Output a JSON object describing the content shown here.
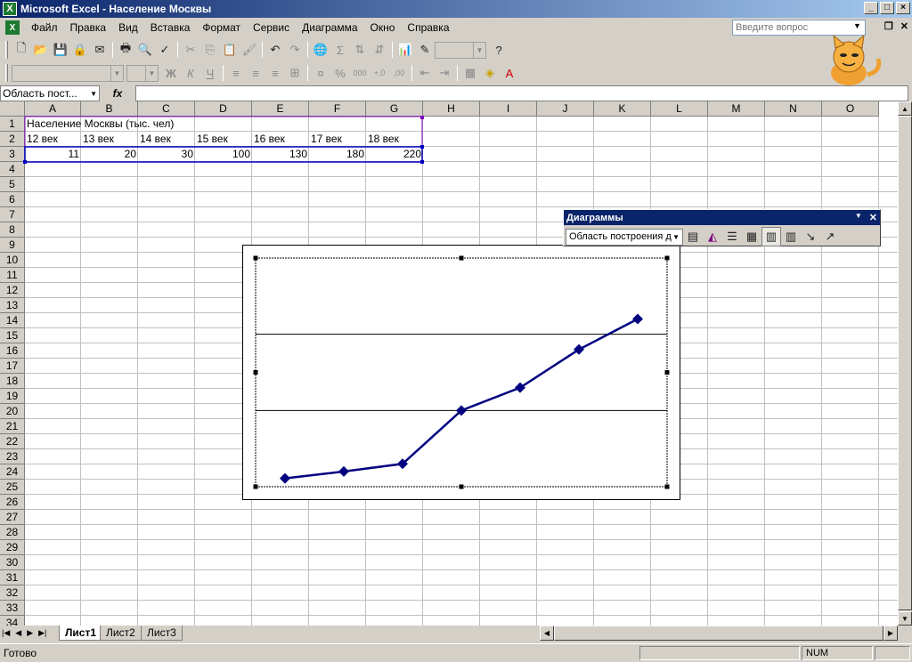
{
  "window": {
    "title": "Microsoft Excel - Население Москвы"
  },
  "menu": [
    "Файл",
    "Правка",
    "Вид",
    "Вставка",
    "Формат",
    "Сервис",
    "Диаграмма",
    "Окно",
    "Справка"
  ],
  "help_box": {
    "placeholder": "Введите вопрос"
  },
  "formula_bar": {
    "name_box": "Область пост...",
    "fx": "fx"
  },
  "columns": [
    "A",
    "B",
    "C",
    "D",
    "E",
    "F",
    "G",
    "H",
    "I",
    "J",
    "K",
    "L",
    "M",
    "N",
    "O"
  ],
  "rows": [
    "1",
    "2",
    "3",
    "4",
    "5",
    "6",
    "7",
    "8",
    "9",
    "10",
    "11",
    "12",
    "13",
    "14",
    "15",
    "16",
    "17",
    "18",
    "19",
    "20",
    "21",
    "22",
    "23",
    "24",
    "25",
    "26",
    "27",
    "28",
    "29",
    "30",
    "31",
    "32",
    "33",
    "34"
  ],
  "cells": {
    "a1": "Население Москвы (тыс. чел)",
    "headers": [
      "12 век",
      "13 век",
      "14 век",
      "15 век",
      "16 век",
      "17 век",
      "18 век"
    ],
    "values": [
      "11",
      "20",
      "30",
      "100",
      "130",
      "180",
      "220"
    ]
  },
  "chart_toolbar": {
    "title": "Диаграммы",
    "combo": "Область построения д"
  },
  "chart_data": {
    "type": "line",
    "categories": [
      "12 век",
      "13 век",
      "14 век",
      "15 век",
      "16 век",
      "17 век",
      "18 век"
    ],
    "values": [
      11,
      20,
      30,
      100,
      130,
      180,
      220
    ],
    "title": "",
    "xlabel": "",
    "ylabel": "",
    "grid": true,
    "legend": "none",
    "series_color": "#000080"
  },
  "sheets": [
    "Лист1",
    "Лист2",
    "Лист3"
  ],
  "status": {
    "text": "Готово",
    "num": "NUM"
  }
}
